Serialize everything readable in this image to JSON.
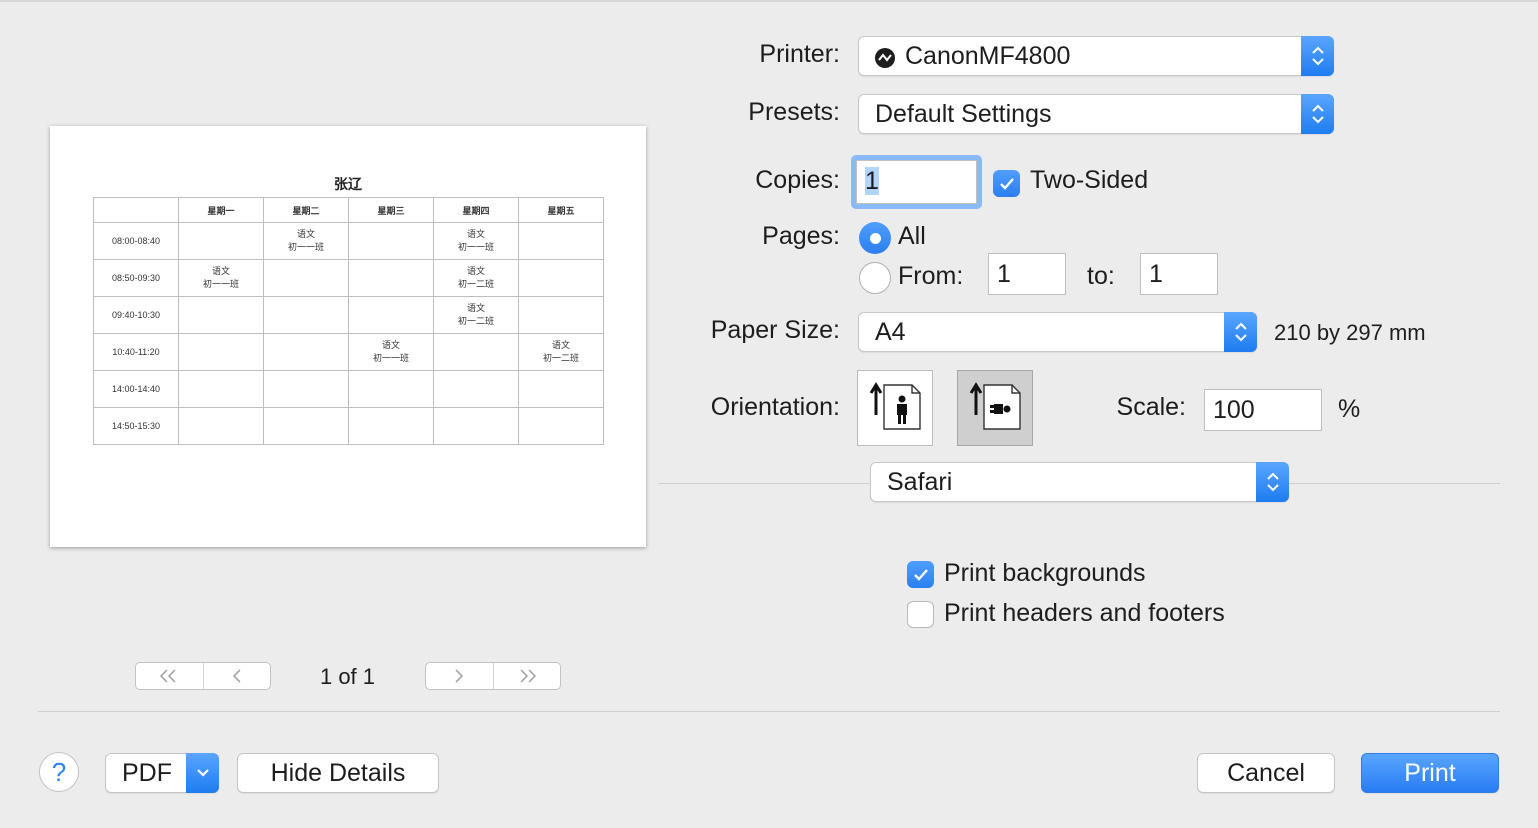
{
  "preview": {
    "title": "张辽",
    "headers": [
      "",
      "星期一",
      "星期二",
      "星期三",
      "星期四",
      "星期五"
    ],
    "rows": [
      [
        "08:00-08:40",
        "",
        "语文\n初一一班",
        "",
        "语文\n初一一班",
        ""
      ],
      [
        "08:50-09:30",
        "语文\n初一一班",
        "",
        "",
        "语文\n初一二班",
        ""
      ],
      [
        "09:40-10:30",
        "",
        "",
        "",
        "语文\n初一二班",
        ""
      ],
      [
        "10:40-11:20",
        "",
        "",
        "语文\n初一一班",
        "",
        "语文\n初一二班"
      ],
      [
        "14:00-14:40",
        "",
        "",
        "",
        "",
        ""
      ],
      [
        "14:50-15:30",
        "",
        "",
        "",
        "",
        ""
      ]
    ]
  },
  "nav": {
    "first_label": "<<",
    "prev_label": "<",
    "page_indicator": "1 of 1",
    "next_label": ">",
    "last_label": ">>"
  },
  "form": {
    "printer_label": "Printer:",
    "printer_value": "CanonMF4800",
    "presets_label": "Presets:",
    "presets_value": "Default Settings",
    "copies_label": "Copies:",
    "copies_value": "1",
    "two_sided_label": "Two-Sided",
    "two_sided_checked": true,
    "pages_label": "Pages:",
    "pages_all_label": "All",
    "pages_from_label": "From:",
    "pages_from_value": "1",
    "pages_to_label": "to:",
    "pages_to_value": "1",
    "paper_size_label": "Paper Size:",
    "paper_size_value": "A4",
    "paper_size_dims": "210 by 297 mm",
    "orientation_label": "Orientation:",
    "orientation_selected": "landscape",
    "scale_label": "Scale:",
    "scale_value": "100",
    "scale_unit": "%",
    "section_value": "Safari",
    "print_backgrounds_label": "Print backgrounds",
    "print_backgrounds_checked": true,
    "print_headers_label": "Print headers and footers",
    "print_headers_checked": false
  },
  "footer": {
    "help_label": "?",
    "pdf_label": "PDF",
    "hide_details_label": "Hide Details",
    "cancel_label": "Cancel",
    "print_label": "Print"
  },
  "colors": {
    "accent": "#2c7ff0",
    "background": "#ececec"
  }
}
